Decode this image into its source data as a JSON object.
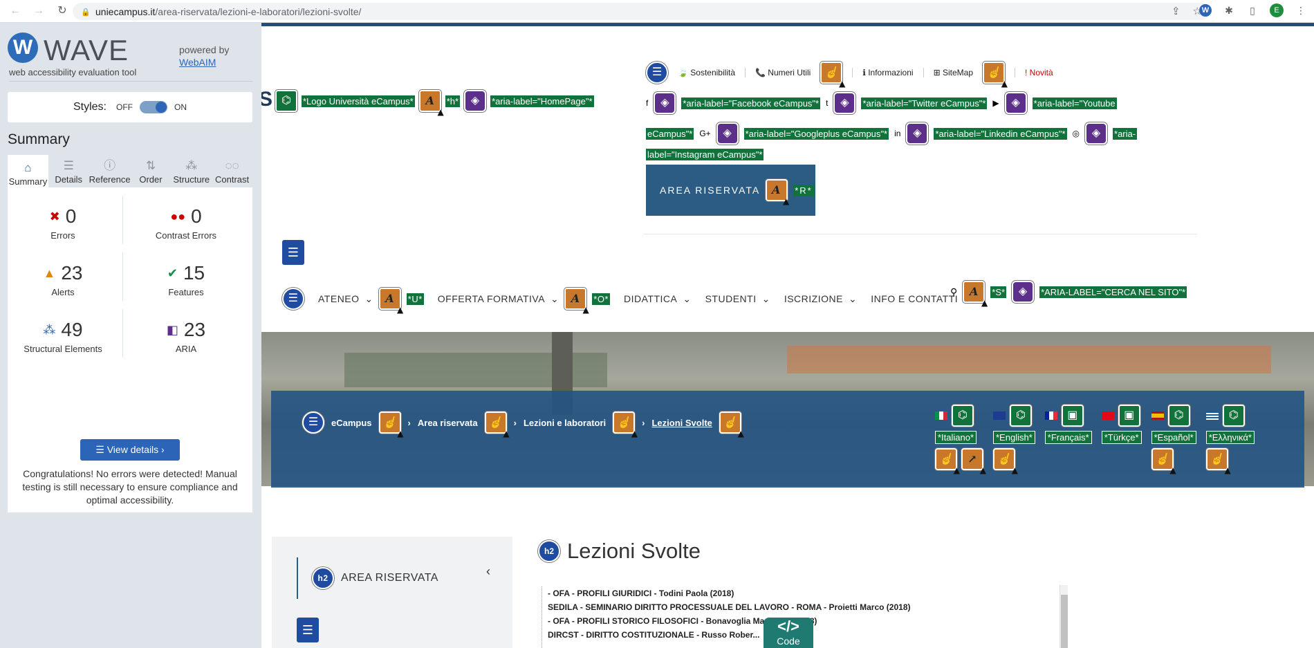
{
  "browser": {
    "url_host": "uniecampus.it",
    "url_path": "/area-riservata/lezioni-e-laboratori/lezioni-svolte/",
    "avatar_letter": "E"
  },
  "wave": {
    "name": "WAVE",
    "subtitle": "web accessibility evaluation tool",
    "powered_by": "powered by",
    "webaim": "WebAIM",
    "styles_label": "Styles:",
    "off": "OFF",
    "on": "ON",
    "summary_title": "Summary",
    "tabs": [
      "Summary",
      "Details",
      "Reference",
      "Order",
      "Structure",
      "Contrast"
    ],
    "stats": {
      "errors": {
        "value": "0",
        "label": "Errors"
      },
      "contrast": {
        "value": "0",
        "label": "Contrast Errors"
      },
      "alerts": {
        "value": "23",
        "label": "Alerts"
      },
      "features": {
        "value": "15",
        "label": "Features"
      },
      "structural": {
        "value": "49",
        "label": "Structural Elements"
      },
      "aria": {
        "value": "23",
        "label": "ARIA"
      }
    },
    "view_details": "View details ›",
    "congrats": "Congratulations! No errors were detected! Manual testing is still necessary to ensure compliance and optimal accessibility."
  },
  "site": {
    "logo_tag": "*Logo Università eCampus*",
    "h_tag": "*h*",
    "homepage_tag": "*aria-label=\"HomePage\"*",
    "topnav": [
      "Sostenibilità",
      "Numeri Utili",
      "Informazioni",
      "SiteMap",
      "Novità"
    ],
    "social": {
      "facebook": "*aria-label=\"Facebook eCampus\"*",
      "twitter": "*aria-label=\"Twitter eCampus\"*",
      "youtube_a": "*aria-label=\"Youtube",
      "youtube_b": "eCampus\"*",
      "googleplus": "*aria-label=\"Googleplus eCampus\"*",
      "linkedin": "*aria-label=\"Linkedin eCampus\"*",
      "instagram_a": "*aria-",
      "instagram_b": "label=\"Instagram eCampus\"*"
    },
    "area_riservata": "AREA RISERVATA",
    "r_tag": "*R*",
    "mainnav": [
      {
        "label": "ATENEO",
        "tag": "*U*"
      },
      {
        "label": "OFFERTA FORMATIVA",
        "tag": "*O*"
      },
      {
        "label": "DIDATTICA"
      },
      {
        "label": "STUDENTI"
      },
      {
        "label": "ISCRIZIONE"
      },
      {
        "label": "INFO E CONTATTI"
      }
    ],
    "search_tag": "*S*",
    "search_aria": "*ARIA-LABEL=\"CERCA NEL SITO\"*",
    "breadcrumb": [
      "eCampus",
      "Area riservata",
      "Lezioni e laboratori",
      "Lezioni Svolte"
    ],
    "languages": [
      "*Italiano*",
      "*English*",
      "*Français*",
      "*Türkçe*",
      "*Español*",
      "*Ελληνικά*"
    ],
    "side_heading": "AREA RISERVATA",
    "page_title": "Lezioni Svolte",
    "h2": "h2",
    "lessons": [
      "- OFA - PROFILI GIURIDICI - Todini Paola (2018)",
      "SEDILA - SEMINARIO DIRITTO PROCESSUALE DEL LAVORO - ROMA - Proietti Marco (2018)",
      "- OFA - PROFILI STORICO FILOSOFICI - Bonavoglia Ma... ...no (2018)",
      "DIRCST - DIRITTO COSTITUZIONALE - Russo Rober..."
    ],
    "code_label": "Code"
  }
}
